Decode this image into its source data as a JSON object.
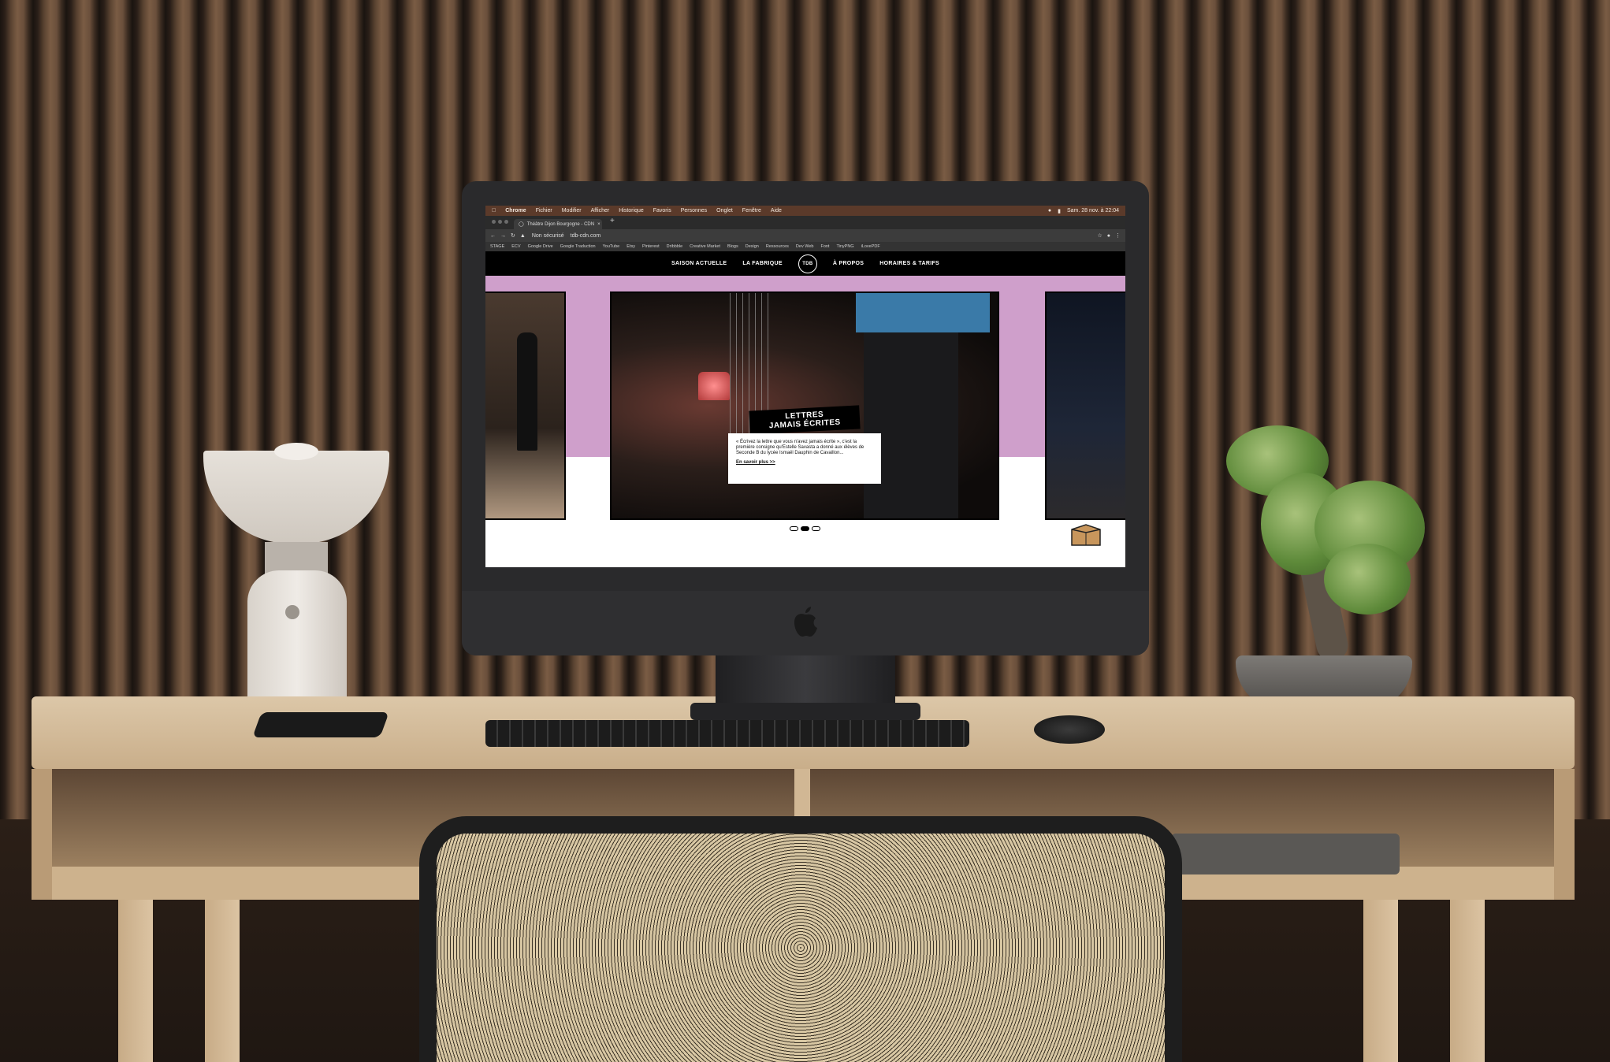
{
  "os_menubar": {
    "items": [
      "Chrome",
      "Fichier",
      "Modifier",
      "Afficher",
      "Historique",
      "Favoris",
      "Personnes",
      "Onglet",
      "Fenêtre",
      "Aide"
    ],
    "clock": "Sam. 28 nov. à 22:04"
  },
  "browser": {
    "tab_title": "Théâtre Dijon Bourgogne - CDN",
    "new_tab": "+",
    "security_label": "Non sécurisé",
    "url": "tdb-cdn.com",
    "bookmarks": [
      "STAGE",
      "ECV",
      "Google Drive",
      "Google Traduction",
      "YouTube",
      "Etsy",
      "Pinterest",
      "Dribbble",
      "Creative Market",
      "Blogs",
      "Design",
      "Ressources",
      "Dev Web",
      "Font",
      "TinyPNG",
      "iLovePDF"
    ]
  },
  "site": {
    "nav": {
      "left": [
        "SAISON ACTUELLE",
        "LA FABRIQUE"
      ],
      "logo": "TDB",
      "right": [
        "À PROPOS",
        "HORAIRES & TARIFS"
      ]
    },
    "hero": {
      "title_line1": "LETTRES",
      "title_line2": "JAMAIS ÉCRITES",
      "description": "« Écrivez la lettre que vous n'avez jamais écrite », c'est la première consigne qu'Estelle Savasta a donné aux élèves de Seconde B du lycée Ismaël Dauphin de Cavaillon...",
      "more_link": "En savoir plus >>",
      "active_slide": 2,
      "slide_count": 3
    },
    "colors": {
      "pink_band": "#cf9fcb",
      "nav_bg": "#000000",
      "box_icon": "#c8965c"
    }
  }
}
